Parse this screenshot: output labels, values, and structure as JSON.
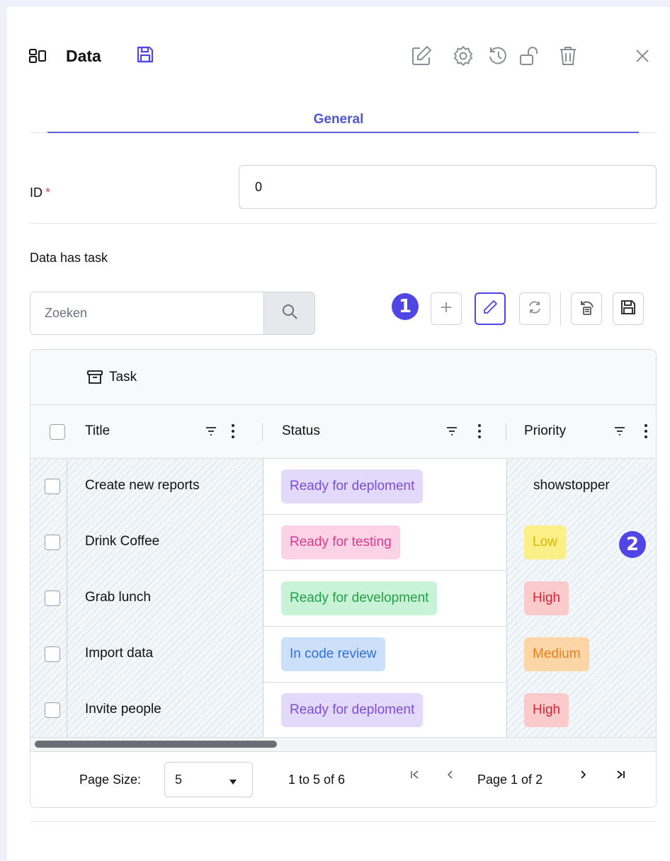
{
  "header": {
    "title": "Data",
    "icons": [
      "layout-icon",
      "save-icon",
      "edit-icon",
      "settings-icon",
      "history-icon",
      "unlock-icon",
      "delete-icon",
      "close-icon"
    ]
  },
  "tabs": [
    {
      "label": "General",
      "active": true
    }
  ],
  "form": {
    "id_label": "ID",
    "id_required_mark": "*",
    "id_value": "0"
  },
  "section": {
    "label": "Data has task"
  },
  "toolbar": {
    "search_placeholder": "Zoeken",
    "buttons": [
      "add-icon",
      "edit-icon",
      "refresh-icon",
      "restore-icon",
      "save-icon"
    ],
    "active_button": "edit-icon"
  },
  "annotations": [
    "1",
    "2"
  ],
  "grid": {
    "group_label": "Task",
    "columns": [
      "Title",
      "Status",
      "Priority"
    ],
    "rows": [
      {
        "title": "Create new reports",
        "status": "Ready for deploment",
        "priority": "showstopper"
      },
      {
        "title": "Drink Coffee",
        "status": "Ready for testing",
        "priority": "Low"
      },
      {
        "title": "Grab lunch",
        "status": "Ready for development",
        "priority": "High"
      },
      {
        "title": "Import data",
        "status": "In code review",
        "priority": "Medium"
      },
      {
        "title": "Invite people",
        "status": "Ready for deploment",
        "priority": "High"
      }
    ],
    "status_colors": {
      "Ready for deploment": {
        "bg": "#e3d9fb",
        "fg": "#7c4ddb"
      },
      "Ready for testing": {
        "bg": "#fbd2e6",
        "fg": "#e0398a"
      },
      "Ready for development": {
        "bg": "#c9f3d6",
        "fg": "#22a14a"
      },
      "In code review": {
        "bg": "#cde0fb",
        "fg": "#2f6fdd"
      }
    },
    "priority_colors": {
      "Low": {
        "bg": "#fbef87",
        "fg": "#e0b300"
      },
      "High": {
        "bg": "#fbcaca",
        "fg": "#d6263a"
      },
      "Medium": {
        "bg": "#fcd6a6",
        "fg": "#f07c17"
      }
    },
    "footer": {
      "page_size_label": "Page Size:",
      "page_size_value": "5",
      "range_text": "1 to 5 of 6",
      "page_text": "Page 1 of 2"
    }
  },
  "accent_color": "#4f46e5"
}
